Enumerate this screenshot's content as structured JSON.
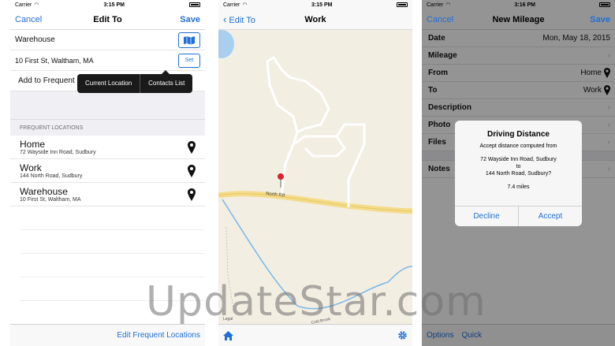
{
  "left": {
    "status": {
      "carrier": "Carrier",
      "time": "3:15 PM"
    },
    "nav": {
      "cancel": "Cancel",
      "title": "Edit To",
      "save": "Save"
    },
    "name_field": "Warehouse",
    "address_field": "10 First St, Waltham, MA",
    "set_label": "Set",
    "add_frequent": "Add to Frequent L",
    "popup": {
      "current": "Current Location",
      "contacts": "Contacts List"
    },
    "section_header": "FREQUENT LOCATIONS",
    "locations": [
      {
        "name": "Home",
        "address": "72 Wayside Inn Road, Sudbury"
      },
      {
        "name": "Work",
        "address": "144 North Road, Sudbury"
      },
      {
        "name": "Warehouse",
        "address": "10 First St, Waltham, MA"
      }
    ],
    "toolbar_label": "Edit Frequent Locations"
  },
  "middle": {
    "status": {
      "carrier": "Carrier",
      "time": "3:15 PM"
    },
    "nav": {
      "back": "Edit To",
      "title": "Work"
    },
    "road_label": "North Rd",
    "legal": "Legal",
    "brook_label": "Cold Brook"
  },
  "right": {
    "status": {
      "carrier": "Carrier",
      "time": "3:16 PM"
    },
    "nav": {
      "cancel": "Cancel",
      "title": "New Mileage",
      "save": "Save"
    },
    "rows": [
      {
        "label": "Date",
        "value": "Mon,  May 18, 2015"
      },
      {
        "label": "Mileage",
        "value": ""
      },
      {
        "label": "From",
        "value": "Home"
      },
      {
        "label": "To",
        "value": "Work"
      },
      {
        "label": "Description",
        "value": ""
      },
      {
        "label": "Photo",
        "value": ""
      },
      {
        "label": "Files",
        "value": ""
      },
      {
        "label": "Notes",
        "value": ""
      }
    ],
    "dialog": {
      "title": "Driving Distance",
      "line1": "Accept distance computed from",
      "from": "72 Wayside Inn Road, Sudbury",
      "to_word": "to",
      "to": "144 North Road, Sudbury?",
      "miles": "7.4 miles",
      "decline": "Decline",
      "accept": "Accept"
    },
    "toolbar": {
      "options": "Options",
      "quick": "Quick"
    }
  },
  "watermark": "UpdateStar.com",
  "colors": {
    "accent": "#1f6fd6",
    "map_bg": "#f3eee2",
    "road": "#f4dc8a",
    "water": "#7ab8e8",
    "pin": "#e0202a"
  }
}
